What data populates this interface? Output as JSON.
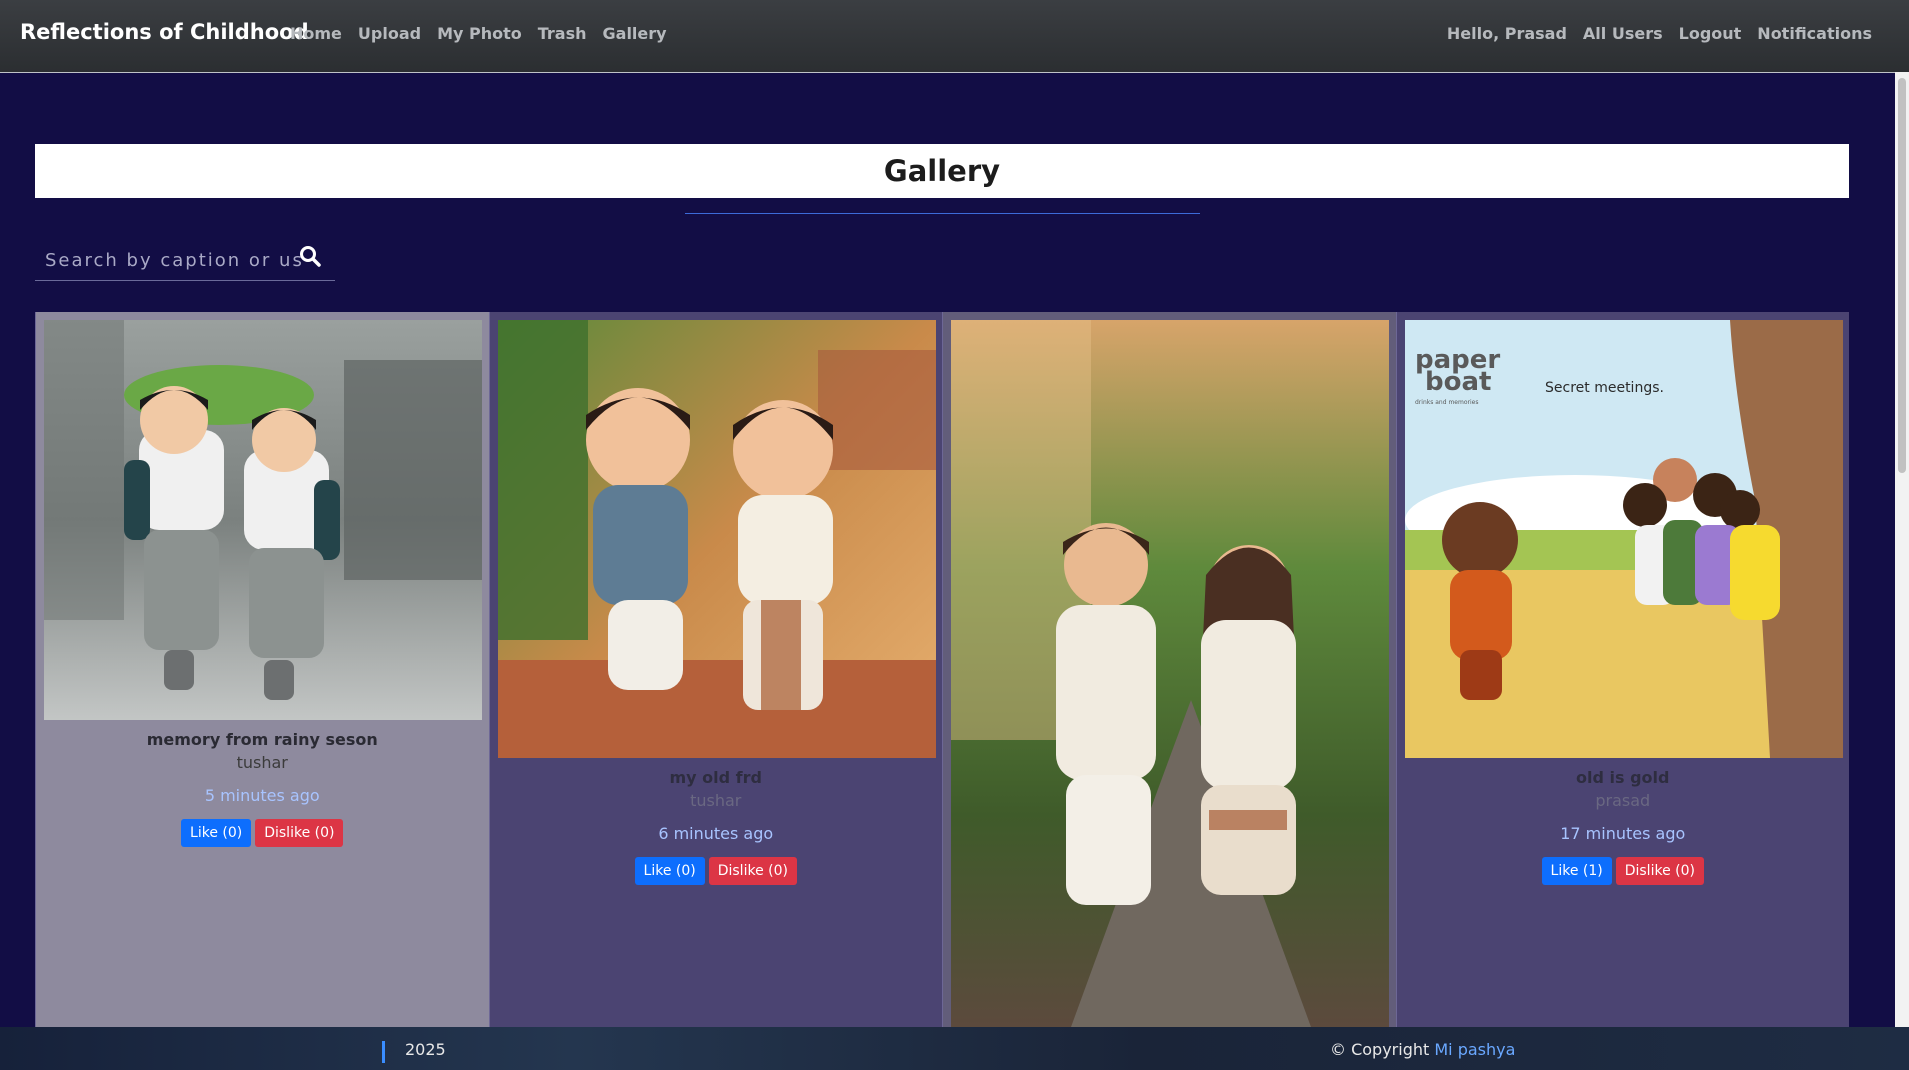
{
  "navbar": {
    "brand": "Reflections of Childhood",
    "left_links": [
      "Home",
      "Upload",
      "My Photo",
      "Trash",
      "Gallery"
    ],
    "right_links": [
      "Hello, Prasad",
      "All Users",
      "Logout",
      "Notifications"
    ]
  },
  "gallery": {
    "title": "Gallery",
    "search_placeholder": "Search by caption or us",
    "search_icon": "search-icon"
  },
  "cards": [
    {
      "caption": "memory from rainy seson",
      "author": "tushar",
      "time": "5 minutes ago",
      "like_label": "Like (0)",
      "dislike_label": "Dislike (0)"
    },
    {
      "caption": "my old frd",
      "author": "tushar",
      "time": "6 minutes ago",
      "like_label": "Like (0)",
      "dislike_label": "Dislike (0)"
    },
    {
      "caption": "",
      "author": "",
      "time": "",
      "like_label": "",
      "dislike_label": ""
    },
    {
      "caption": "old is gold",
      "author": "prasad",
      "time": "17 minutes ago",
      "like_label": "Like (1)",
      "dislike_label": "Dislike (0)",
      "image_text": {
        "logo_line1": "paper",
        "logo_line2": "boat",
        "logo_sub": "drinks and memories",
        "tagline": "Secret meetings."
      }
    }
  ],
  "footer": {
    "year": "2025",
    "copyright": "© Copyright",
    "author": "Mi pashya"
  }
}
